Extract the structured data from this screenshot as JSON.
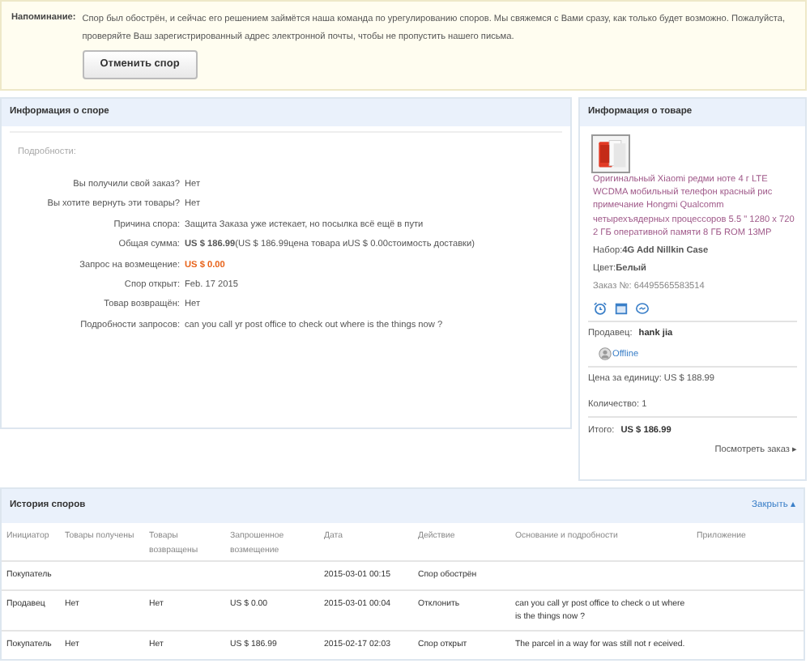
{
  "reminder": {
    "label": "Напоминание:",
    "text": "Спор был обострён, и сейчас его решением займётся наша команда по урегулированию споров. Мы свяжемся с Вами сразу, как только будет возможно. Пожалуйста, проверяйте Ваш зарегистрированный адрес электронной почты, чтобы не пропустить нашего письма.",
    "button": "Отменить спор"
  },
  "dispute": {
    "title": "Информация о споре",
    "section": "Подробности:",
    "fields": [
      {
        "label": "Вы получили свой заказ?",
        "value": "Нет",
        "kind": "plain"
      },
      {
        "label": "Вы хотите вернуть эти товары?",
        "value": "Нет",
        "kind": "plain"
      },
      {
        "label": "Причина спора:",
        "value": "Защита Заказа уже истекает, но посылка всё ещё в пути",
        "kind": "plain"
      },
      {
        "label": "Общая сумма:",
        "value": "**US $ 186.99**(US $ 186.99цена товара иUS $ 0.00стоимость доставки)",
        "kind": "plain"
      },
      {
        "label": "Запрос на возмещение:",
        "value": "US $ 0.00",
        "kind": "highlight"
      },
      {
        "label": "Спор открыт:",
        "value": "Feb. 17 2015",
        "kind": "plain"
      },
      {
        "label": "Товар возвращён:",
        "value": "Нет",
        "kind": "plain"
      },
      {
        "label": "Подробности запросов:",
        "value": "can you call yr post office to check out where is the things now ?",
        "kind": "plain"
      }
    ]
  },
  "product": {
    "title": "Информация о товаре",
    "name": "Оригинальный Xiaomi редми ноте 4 г LTE WCDMA мобильный телефон красный рис примечание Hongmi Qualcomm четырехъядерных процессоров 5.5 \" 1280 x 720 2 ГБ оперативной памяти 8 ГБ ROM 13MP",
    "set": "Набор:**4G Add Nillkin Case**",
    "variant": "Цвет:**Белый**",
    "order": "Заказ №: 64495565583514",
    "seller_label": "Продавец:",
    "seller": "hank jia",
    "status": "Offline",
    "unit_price": "Цена за единицу:  US $ 188.99",
    "quantity": "Количество:  1",
    "total_label": "Итого:",
    "total": "US $ 186.99",
    "view_order": "Посмотреть заказ ▸"
  },
  "history": {
    "title": "История споров",
    "toggle": "Закрыть ▴",
    "columns": [
      "Инициатор",
      "Товары получены",
      "Товары возвращены",
      "Запрошенное возмещение",
      "Дата",
      "Действие",
      "Основание и подробности",
      "Приложение"
    ],
    "rows": [
      [
        "Покупатель",
        "",
        "",
        "",
        "2015-03-01 00:15",
        "Спор обострён",
        "",
        ""
      ],
      [
        "Продавец",
        "Нет",
        "Нет",
        "US $ 0.00",
        "2015-03-01 00:04",
        "Отклонить",
        "can you call yr post office to check o ut where is the things now ?",
        ""
      ],
      [
        "Покупатель",
        "Нет",
        "Нет",
        "US $ 186.99",
        "2015-02-17 02:03",
        "Спор открыт",
        "The parcel in a way for was still not r eceived.",
        ""
      ]
    ]
  }
}
